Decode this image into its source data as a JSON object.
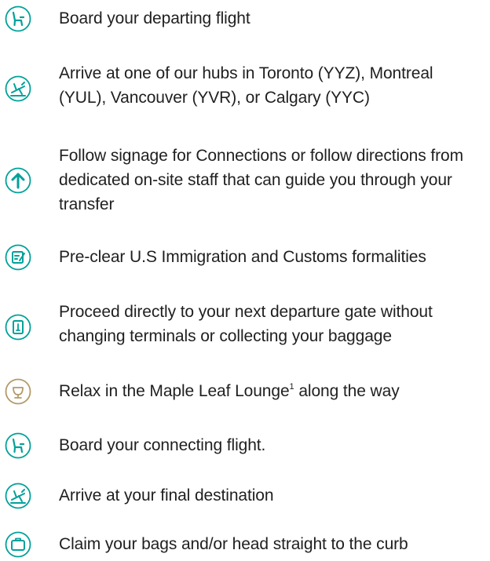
{
  "colors": {
    "teal": "#00a19a",
    "gold": "#b39a6a",
    "text": "#1f1f1f"
  },
  "steps": [
    {
      "icon": "seat-icon",
      "text": "Board your departing flight"
    },
    {
      "icon": "plane-arrive-icon",
      "text": "Arrive at one of our hubs in Toronto (YYZ), Montreal (YUL), Vancouver (YVR), or Calgary (YYC)"
    },
    {
      "icon": "arrow-up-icon",
      "text": "Follow signage for Connections or follow directions from dedicated on-site staff that can guide you through your transfer"
    },
    {
      "icon": "customs-form-icon",
      "text": "Pre-clear U.S Immigration and Customs formalities"
    },
    {
      "icon": "gate-icon",
      "text": "Proceed directly to your next departure gate without changing terminals or collecting your baggage"
    },
    {
      "icon": "lounge-icon",
      "text": "Relax in the Maple Leaf Lounge",
      "sup": "1",
      "text_after": " along the way"
    },
    {
      "icon": "seat-icon",
      "text": "Board your connecting flight."
    },
    {
      "icon": "plane-arrive-icon",
      "text": "Arrive at your final destination"
    },
    {
      "icon": "baggage-icon",
      "text": "Claim your bags and/or head straight to the curb"
    }
  ]
}
